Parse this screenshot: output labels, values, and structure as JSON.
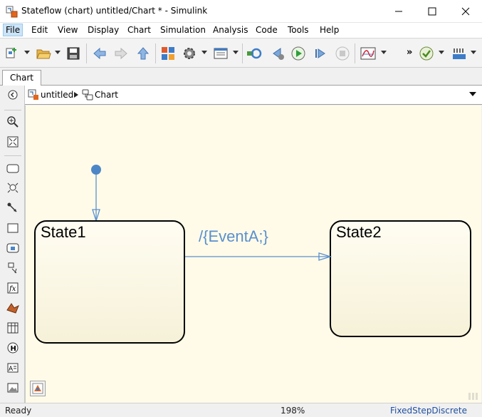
{
  "window": {
    "title": "Stateflow (chart) untitled/Chart * - Simulink",
    "app_icon": "stateflow-app-icon",
    "controls": [
      "minimize-icon",
      "maximize-icon",
      "close-icon"
    ]
  },
  "menu": {
    "items": [
      {
        "label": "File",
        "active": true
      },
      {
        "label": "Edit"
      },
      {
        "label": "View"
      },
      {
        "label": "Display"
      },
      {
        "label": "Chart"
      },
      {
        "label": "Simulation"
      },
      {
        "label": "Analysis"
      },
      {
        "label": "Code"
      },
      {
        "label": "Tools"
      },
      {
        "label": "Help"
      }
    ]
  },
  "toolbar": {
    "items": [
      "new-model-icon",
      "open-folder-icon",
      "save-icon",
      "back-arrow-icon",
      "forward-arrow-icon",
      "up-arrow-icon",
      "library-browser-icon",
      "model-settings-gear-icon",
      "model-explorer-icon",
      "update-diagram-icon",
      "step-back-icon",
      "run-icon",
      "step-forward-icon",
      "stop-icon",
      "scope-icon",
      "more-chevron-icon",
      "model-advisor-check-icon",
      "sample-time-icon"
    ],
    "more_label": "»"
  },
  "tabs": [
    {
      "label": "Chart"
    }
  ],
  "breadcrumb": {
    "items": [
      {
        "label": "untitled",
        "icon": "simulink-model-icon"
      },
      {
        "label": "Chart",
        "icon": "stateflow-chart-icon"
      }
    ]
  },
  "palette": {
    "tools": [
      "hide-palette-icon",
      "zoom-in-icon",
      "fit-to-view-icon",
      "state-tool-icon",
      "default-transition-tool-icon",
      "connective-junction-icon",
      "box-tool-icon",
      "simulink-state-icon",
      "simulink-function-icon",
      "graphical-function-icon",
      "matlab-function-icon",
      "truth-table-icon",
      "history-junction-icon",
      "annotation-tool-icon",
      "image-tool-icon"
    ]
  },
  "diagram": {
    "states": [
      {
        "name": "State1"
      },
      {
        "name": "State2"
      }
    ],
    "transitions": [
      {
        "label": "/{EventA;}",
        "from": "State1",
        "to": "State2"
      }
    ],
    "default_transition_target": "State1",
    "colors": {
      "canvas": "#fffbe8",
      "state_fill_top": "#fffdf2",
      "state_fill_bottom": "#f6f1d8",
      "state_border": "#000000",
      "transition": "#5a8fcf"
    }
  },
  "statusbar": {
    "status": "Ready",
    "zoom": "198%",
    "solver": "FixedStepDiscrete"
  }
}
